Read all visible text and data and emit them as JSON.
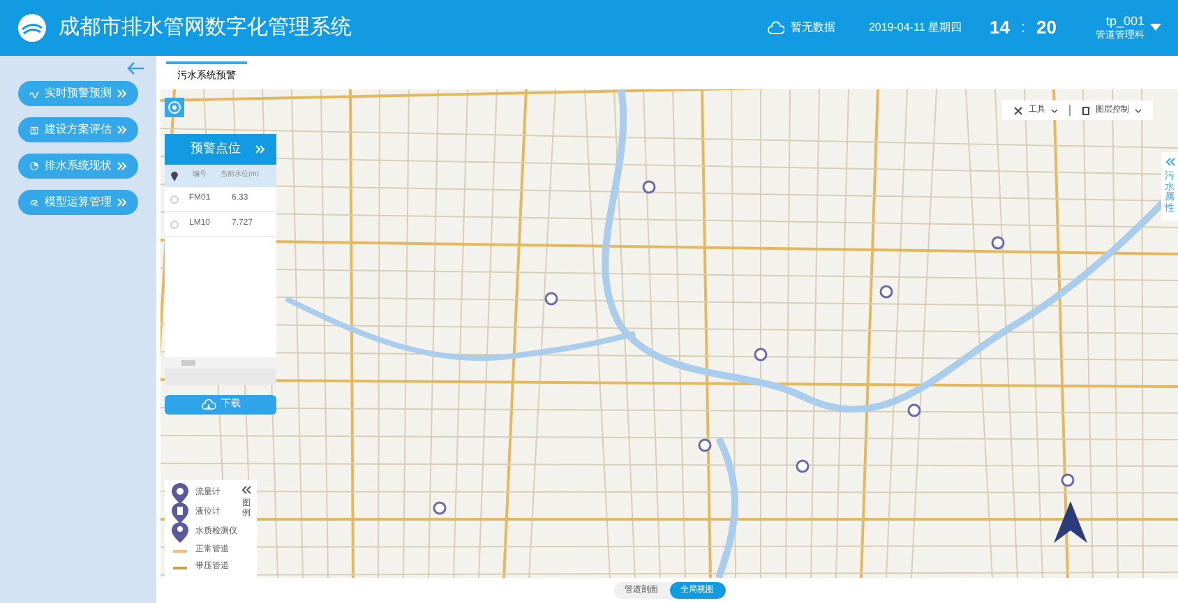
{
  "header": {
    "title": "成都市排水管网数字化管理系统",
    "weather": "暂无数据",
    "date": "2019-04-11 星期四",
    "hour": "14",
    "separator": ":",
    "minute": "20",
    "user": "tp_001",
    "department": "管道管理科"
  },
  "sidebar": {
    "items": [
      {
        "label": "实时预警预测",
        "selected": false
      },
      {
        "label": "建设方案评估",
        "selected": false
      },
      {
        "label": "排水系统现状",
        "selected": false
      },
      {
        "label": "模型运算管理",
        "selected": false
      }
    ]
  },
  "tabs": [
    {
      "label": "污水系统预警",
      "selected": true
    }
  ],
  "warning_panel": {
    "title": "预警点位",
    "columns": [
      "编号",
      "当前水位(m)"
    ],
    "rows": [
      {
        "id": "FM01",
        "level_text": "6.33",
        "checked": false
      },
      {
        "id": "LM10",
        "level_text": "7.727",
        "checked": false
      }
    ],
    "download": "下载"
  },
  "toolbar": {
    "tools": "工具",
    "layers": "图层控制"
  },
  "side_tab": {
    "label": "污水属性"
  },
  "legend": {
    "title": "图例",
    "items": [
      {
        "kind": "marker",
        "label": "流量计"
      },
      {
        "kind": "marker",
        "label": "液位计"
      },
      {
        "kind": "marker",
        "label": "水质检测仪"
      },
      {
        "kind": "line",
        "label": "正常管道",
        "color": "#f0c070"
      },
      {
        "kind": "line",
        "label": "带压管道",
        "color": "#c8a050"
      }
    ]
  },
  "view_switch": [
    {
      "label": "管道剖面",
      "selected": false
    },
    {
      "label": "全局视图",
      "selected": true
    }
  ]
}
